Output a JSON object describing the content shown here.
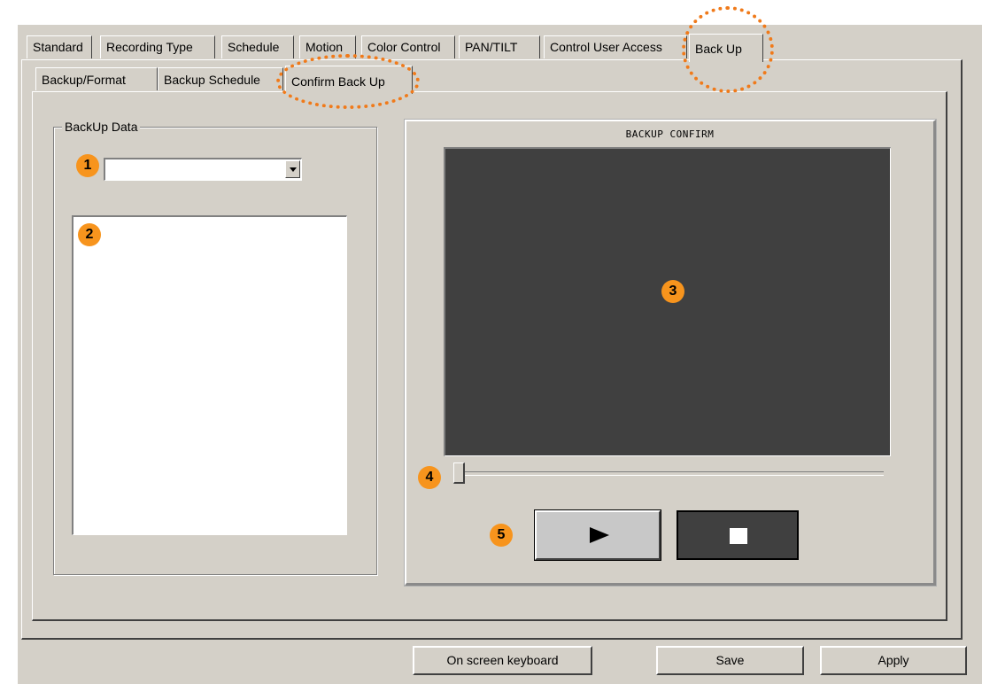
{
  "tabs": [
    {
      "label": "Standard"
    },
    {
      "label": "Recording Type"
    },
    {
      "label": "Schedule"
    },
    {
      "label": "Motion"
    },
    {
      "label": "Color Control"
    },
    {
      "label": "PAN/TILT"
    },
    {
      "label": "Control User Access"
    },
    {
      "label": "Back Up",
      "active": true
    }
  ],
  "subtabs": [
    {
      "label": "Backup/Format"
    },
    {
      "label": "Backup Schedule"
    },
    {
      "label": "Confirm Back Up",
      "active": true
    }
  ],
  "backup_data": {
    "group_title": "BackUp Data",
    "combo_value": "",
    "list_items": []
  },
  "confirm": {
    "title": "BACKUP CONFIRM",
    "progress": 0
  },
  "footer": {
    "keyboard_label": "On screen keyboard",
    "save_label": "Save",
    "apply_label": "Apply"
  },
  "markers": [
    "1",
    "2",
    "3",
    "4",
    "5"
  ],
  "colors": {
    "window_bg": "#d4d0c8",
    "video_bg": "#404040",
    "marker": "#f7941d",
    "highlight_dots": "#f07a1a"
  }
}
